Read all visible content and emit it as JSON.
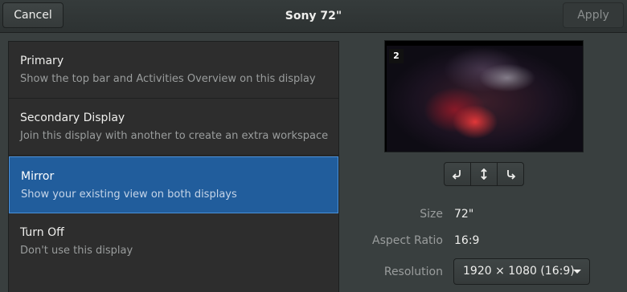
{
  "header": {
    "cancel_label": "Cancel",
    "title": "Sony 72\"",
    "apply_label": "Apply"
  },
  "modes": [
    {
      "title": "Primary",
      "description": "Show the top bar and Activities Overview on this display",
      "selected": false
    },
    {
      "title": "Secondary Display",
      "description": "Join this display with another to create an extra workspace",
      "selected": false
    },
    {
      "title": "Mirror",
      "description": "Show your existing view on both displays",
      "selected": true
    },
    {
      "title": "Turn Off",
      "description": "Don't use this display",
      "selected": false
    }
  ],
  "preview": {
    "display_number": "2"
  },
  "rotation": {
    "buttons": [
      "rotate-left-icon",
      "rotate-180-icon",
      "rotate-right-icon"
    ]
  },
  "info": {
    "size_label": "Size",
    "size_value": "72\"",
    "aspect_label": "Aspect Ratio",
    "aspect_value": "16:9",
    "resolution_label": "Resolution",
    "resolution_value": "1920 × 1080 (16:9)"
  },
  "colors": {
    "accent": "#215d9c",
    "accent_border": "#4a90d9",
    "background": "#393f3f"
  }
}
